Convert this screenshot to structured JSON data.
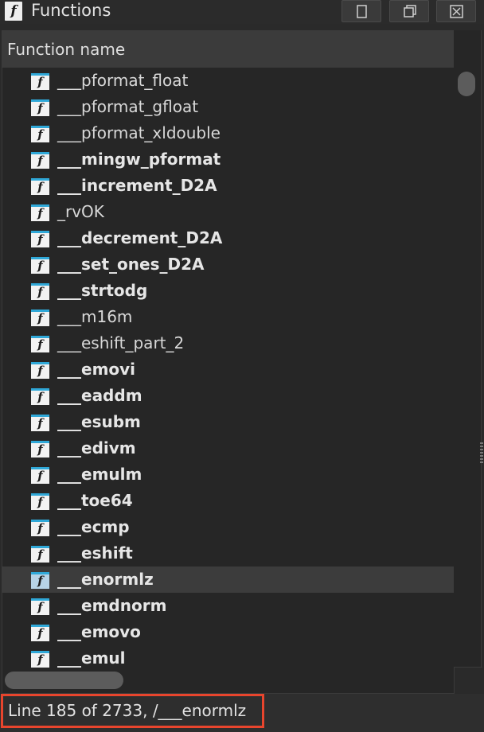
{
  "window": {
    "title": "Functions",
    "title_icon": "function-icon",
    "buttons": [
      "restore-icon",
      "maximize-icon",
      "close-icon"
    ]
  },
  "table": {
    "column_header": "Function name",
    "rows": [
      {
        "name": "___pformat_float",
        "bold": false
      },
      {
        "name": "___pformat_gfloat",
        "bold": false
      },
      {
        "name": "___pformat_xldouble",
        "bold": false
      },
      {
        "name": "___mingw_pformat",
        "bold": true
      },
      {
        "name": "___increment_D2A",
        "bold": true
      },
      {
        "name": "_rvOK",
        "bold": false
      },
      {
        "name": "___decrement_D2A",
        "bold": true
      },
      {
        "name": "___set_ones_D2A",
        "bold": true
      },
      {
        "name": "___strtodg",
        "bold": true
      },
      {
        "name": "___m16m",
        "bold": false
      },
      {
        "name": "___eshift_part_2",
        "bold": false
      },
      {
        "name": "___emovi",
        "bold": true
      },
      {
        "name": "___eaddm",
        "bold": true
      },
      {
        "name": "___esubm",
        "bold": true
      },
      {
        "name": "___edivm",
        "bold": true
      },
      {
        "name": "___emulm",
        "bold": true
      },
      {
        "name": "___toe64",
        "bold": true
      },
      {
        "name": "___ecmp",
        "bold": true
      },
      {
        "name": "___eshift",
        "bold": true
      },
      {
        "name": "___enormlz",
        "bold": true
      },
      {
        "name": "___emdnorm",
        "bold": true
      },
      {
        "name": "___emovo",
        "bold": true
      },
      {
        "name": "___emul",
        "bold": true
      }
    ],
    "selected_index": 19,
    "icon_glyph": "f"
  },
  "status": {
    "text": "Line 185 of 2733, /___enormlz"
  },
  "colors": {
    "accent_highlight": "#e8452d",
    "icon_stripe": "#2fa8d8"
  }
}
